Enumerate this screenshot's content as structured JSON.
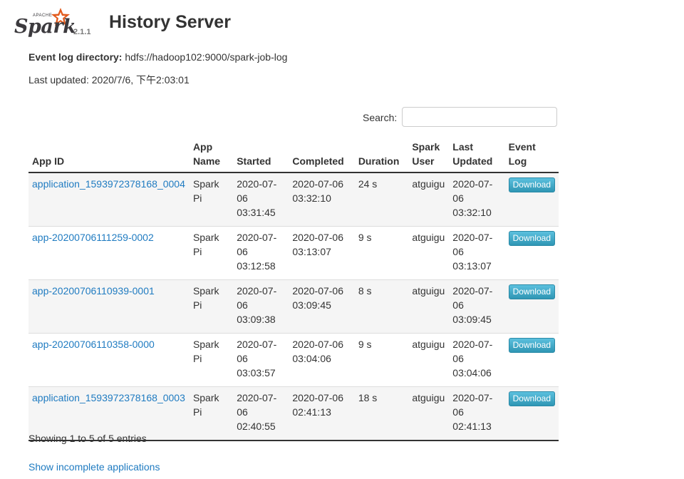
{
  "header": {
    "logo_apache": "APACHE",
    "logo_word": "Spark",
    "version": "2.1.1",
    "title": "History Server"
  },
  "meta": {
    "event_log_label": "Event log directory:",
    "event_log_value": "hdfs://hadoop102:9000/spark-job-log",
    "last_updated_label": "Last updated:",
    "last_updated_value": "2020/7/6, 下午2:03:01"
  },
  "search": {
    "label": "Search:",
    "value": ""
  },
  "table": {
    "headers": [
      "App ID",
      "App Name",
      "Started",
      "Completed",
      "Duration",
      "Spark User",
      "Last Updated",
      "Event Log"
    ],
    "rows": [
      {
        "app_id": "application_1593972378168_0004",
        "app_name": "Spark Pi",
        "started": "2020-07-06 03:31:45",
        "completed": "2020-07-06 03:32:10",
        "duration": "24 s",
        "user": "atguigu",
        "last_updated": "2020-07-06 03:32:10",
        "event_log": "Download"
      },
      {
        "app_id": "app-20200706111259-0002",
        "app_name": "Spark Pi",
        "started": "2020-07-06 03:12:58",
        "completed": "2020-07-06 03:13:07",
        "duration": "9 s",
        "user": "atguigu",
        "last_updated": "2020-07-06 03:13:07",
        "event_log": "Download"
      },
      {
        "app_id": "app-20200706110939-0001",
        "app_name": "Spark Pi",
        "started": "2020-07-06 03:09:38",
        "completed": "2020-07-06 03:09:45",
        "duration": "8 s",
        "user": "atguigu",
        "last_updated": "2020-07-06 03:09:45",
        "event_log": "Download"
      },
      {
        "app_id": "app-20200706110358-0000",
        "app_name": "Spark Pi",
        "started": "2020-07-06 03:03:57",
        "completed": "2020-07-06 03:04:06",
        "duration": "9 s",
        "user": "atguigu",
        "last_updated": "2020-07-06 03:04:06",
        "event_log": "Download"
      },
      {
        "app_id": "application_1593972378168_0003",
        "app_name": "Spark Pi",
        "started": "2020-07-06 02:40:55",
        "completed": "2020-07-06 02:41:13",
        "duration": "18 s",
        "user": "atguigu",
        "last_updated": "2020-07-06 02:41:13",
        "event_log": "Download"
      }
    ]
  },
  "footer": {
    "showing": "Showing 1 to 5 of 5 entries",
    "incomplete_link": "Show incomplete applications"
  },
  "colors": {
    "link": "#1f7bc1",
    "button": "#3aa3c8",
    "logo_star": "#e25a1c"
  },
  "icons": {
    "logo_star": "spark-star-icon"
  }
}
